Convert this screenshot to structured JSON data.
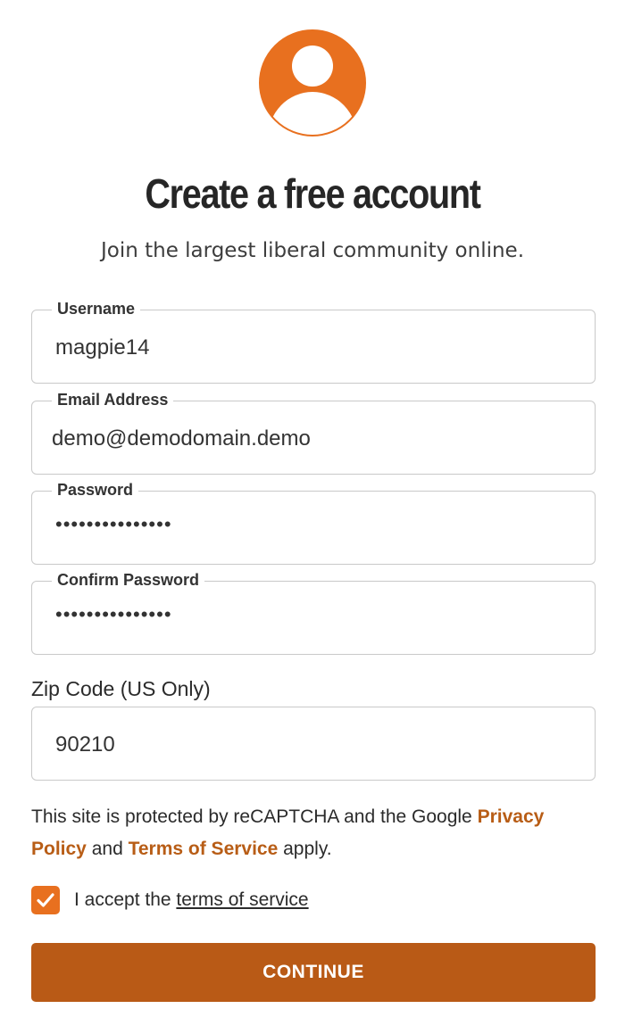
{
  "header": {
    "title": "Create a free account",
    "subtitle": "Join the largest liberal community online."
  },
  "form": {
    "username": {
      "label": "Username",
      "value": "magpie14"
    },
    "email": {
      "label": "Email Address",
      "value": "demo@demodomain.demo"
    },
    "password": {
      "label": "Password",
      "value": "•••••••••••••••"
    },
    "confirm_password": {
      "label": "Confirm Password",
      "value": "•••••••••••••••"
    },
    "zip": {
      "label": "Zip Code (US Only)",
      "value": "90210"
    }
  },
  "legal": {
    "prefix": "This site is protected by reCAPTCHA and the Google ",
    "privacy_link": "Privacy Policy",
    "middle": " and ",
    "terms_link": "Terms of Service",
    "suffix": " apply."
  },
  "accept": {
    "text": "I accept the ",
    "link": "terms of service",
    "checked": true
  },
  "continue_label": "CONTINUE",
  "colors": {
    "accent": "#e8701f",
    "button": "#b95a16",
    "link": "#b85d16"
  },
  "icons": {
    "avatar": "user-avatar-icon",
    "check": "checkmark-icon"
  }
}
